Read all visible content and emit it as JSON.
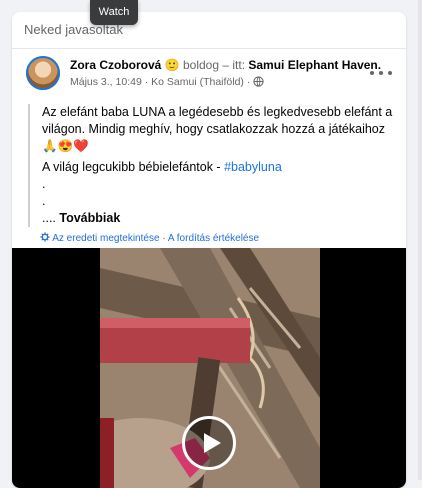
{
  "tooltip": {
    "label": "Watch"
  },
  "section": {
    "label": "Neked javasoltak"
  },
  "post": {
    "author": "Zora Czoborová",
    "emoji": "🙂",
    "feeling": "boldog – itt:",
    "place": "Samui Elephant Haven.",
    "date": "Május 3., 10:49",
    "separator": "·",
    "location": "Ko Samui (Thaiföld)",
    "privacy_separator": "·",
    "text_line1": "Az elefánt baba LUNA a legédesebb és legkedvesebb elefánt a világon. Mindig meghív, hogy csatlakozzak hozzá a játékaihoz🙏😍❤️",
    "text_line2_prefix": "A világ legcukibb bébielefántok -",
    "hashtag": "#babyluna",
    "dot1": ".",
    "dot2": ".",
    "ellipsis": "....",
    "see_more": "Továbbiak",
    "see_original": "Az eredeti megtekintése",
    "link_separator": "·",
    "rate_translation": "A fordítás értékelése"
  },
  "icons": {
    "globe": "globe-icon",
    "more": "more-icon",
    "settings": "gear-icon",
    "play": "play-icon"
  },
  "colors": {
    "link": "#1b74e4",
    "muted": "#65676b",
    "background": "#f0f2f5"
  }
}
